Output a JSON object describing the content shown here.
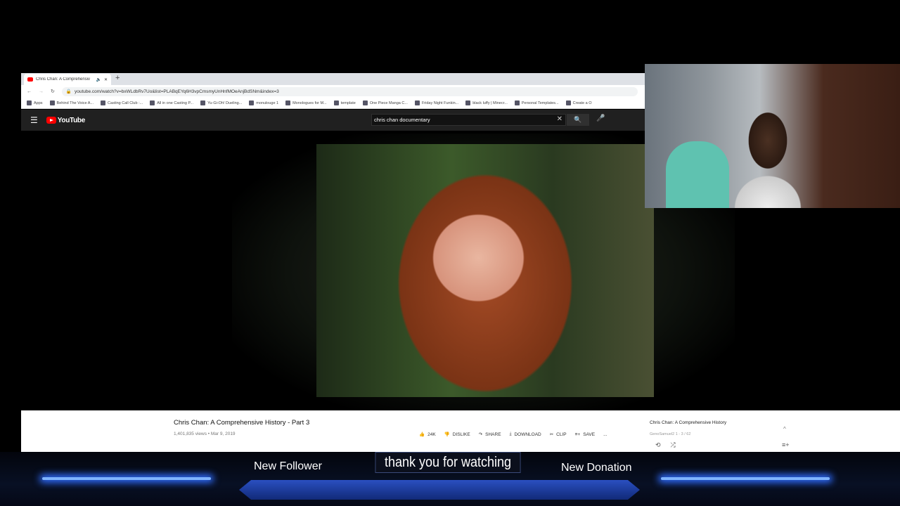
{
  "browser": {
    "tab_title": "Chris Chan: A Comprehensiv",
    "url": "youtube.com/watch?v=bxWLdbRv7Uo&list=PLABqEYq6H3vpCmsmyUnHnfMOeAnjBdSNm&index=3",
    "bookmarks": [
      "Apps",
      "Behind The Voice A...",
      "Casting Call Club :...",
      "All in one Casting P...",
      "Yu-Gi-Oh! Dueling...",
      "monulouge 1",
      "Monologues for M...",
      "template",
      "One Piece Manga C...",
      "Friday Night Funkin...",
      "black luffy | Minecr...",
      "Personal Templates...",
      "Create a O"
    ]
  },
  "youtube": {
    "logo": "YouTube",
    "search_value": "chris chan documentary",
    "video": {
      "title": "Chris Chan: A Comprehensive History - Part 3",
      "meta": "1,401,835 views • Mar 9, 2019",
      "likes": "24K",
      "dislike": "DISLIKE",
      "share": "SHARE",
      "download": "DOWNLOAD",
      "clip": "CLIP",
      "save": "SAVE",
      "more": "..."
    },
    "playlist": {
      "title": "Chris Chan: A Comprehensive History",
      "sub": "GenoSamuel2 1 - 3 / 62"
    }
  },
  "overlay": {
    "new_follower": "New Follower",
    "message": "thank you for watching",
    "new_donation": "New Donation",
    "accent": "#2f6cff"
  }
}
